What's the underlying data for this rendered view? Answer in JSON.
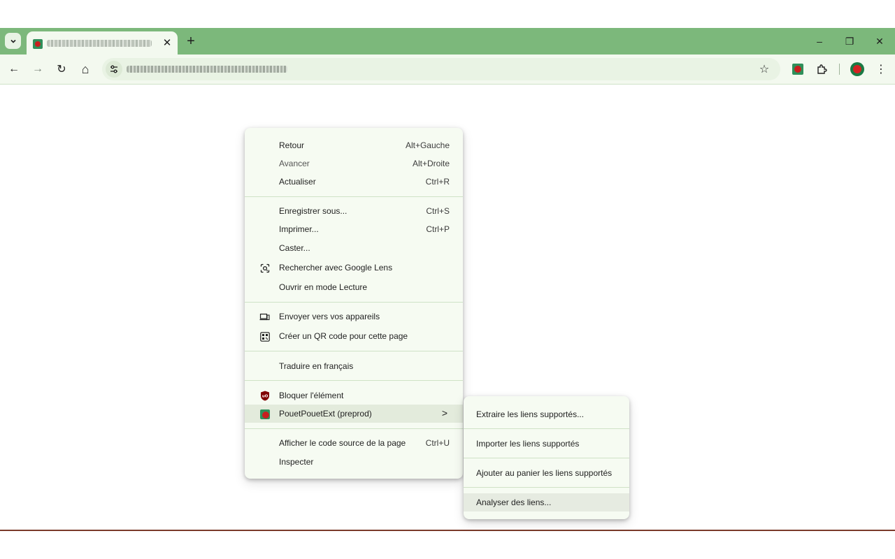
{
  "browser": {
    "tab_search_icon": "chevron-down-icon",
    "tab": {
      "favicon": "pouetpouet-favicon",
      "close_glyph": "✕"
    },
    "new_tab_glyph": "+",
    "window_controls": {
      "minimize": "–",
      "restore": "❐",
      "close": "✕"
    },
    "colors": {
      "tabstrip": "#7cb87b",
      "toolbar": "#f3f9ef",
      "menu_bg": "#f6fbf2"
    }
  },
  "toolbar": {
    "back_glyph": "←",
    "forward_glyph": "→",
    "reload_glyph": "↻",
    "home_glyph": "⌂",
    "bookmark_glyph": "☆",
    "extensions_glyph": "⧉",
    "menu_glyph": "⋮"
  },
  "context_menu": {
    "groups": [
      [
        {
          "label": "Retour",
          "shortcut": "Alt+Gauche"
        },
        {
          "label": "Avancer",
          "shortcut": "Alt+Droite",
          "disabled": true
        },
        {
          "label": "Actualiser",
          "shortcut": "Ctrl+R"
        }
      ],
      [
        {
          "label": "Enregistrer sous...",
          "shortcut": "Ctrl+S"
        },
        {
          "label": "Imprimer...",
          "shortcut": "Ctrl+P"
        },
        {
          "label": "Caster...",
          "shortcut": ""
        },
        {
          "label": "Rechercher avec Google Lens",
          "shortcut": "",
          "icon": "google-lens-icon"
        },
        {
          "label": "Ouvrir en mode Lecture",
          "shortcut": ""
        }
      ],
      [
        {
          "label": "Envoyer vers vos appareils",
          "shortcut": "",
          "icon": "devices-icon"
        },
        {
          "label": "Créer un QR code pour cette page",
          "shortcut": "",
          "icon": "qr-code-icon"
        }
      ],
      [
        {
          "label": "Traduire en français",
          "shortcut": ""
        }
      ],
      [
        {
          "label": "Bloquer l'élément",
          "shortcut": "",
          "icon": "ublock-icon"
        },
        {
          "label": "PouetPouetExt (preprod)",
          "shortcut": "",
          "icon": "pouetpouet-icon",
          "submenu": true,
          "arrow": ">"
        }
      ],
      [
        {
          "label": "Afficher le code source de la page",
          "shortcut": "Ctrl+U"
        },
        {
          "label": "Inspecter",
          "shortcut": ""
        }
      ]
    ]
  },
  "submenu": {
    "items": [
      {
        "label": "Extraire les liens supportés..."
      },
      {
        "label": "Importer les liens supportés"
      },
      {
        "label": "Ajouter au panier les liens supportés"
      },
      {
        "label": "Analyser des liens..."
      }
    ]
  }
}
